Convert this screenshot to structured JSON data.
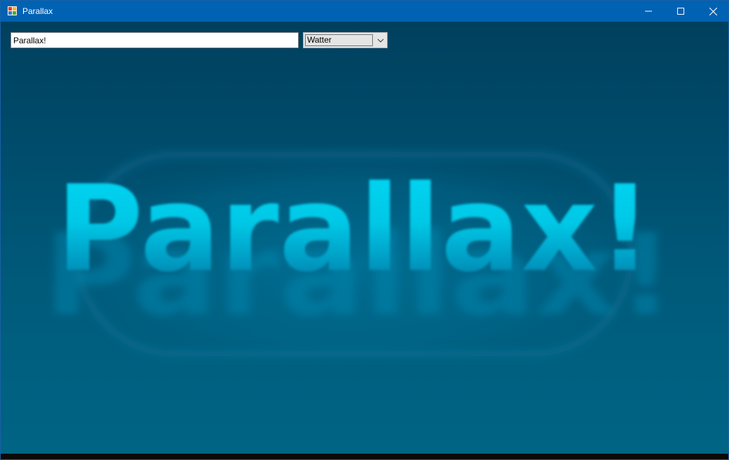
{
  "window": {
    "title": "Parallax",
    "icons": {
      "app": "windows-form-app-icon",
      "minimize": "minimize-icon",
      "maximize": "maximize-icon",
      "close": "close-icon"
    }
  },
  "controls": {
    "text_input_value": "Parallax!",
    "effect_select": {
      "selected": "Watter",
      "icon": "chevron-down-icon"
    }
  },
  "scene": {
    "rendered_text": "Parallax!",
    "colors": {
      "background_top": "#00405e",
      "background_bottom": "#006484",
      "text_bright": "#00d4f0",
      "text_mid": "#00b0d0",
      "glow": "#0090b8"
    }
  },
  "colors": {
    "titlebar": "#0062b3",
    "title_text": "#ffffff"
  }
}
